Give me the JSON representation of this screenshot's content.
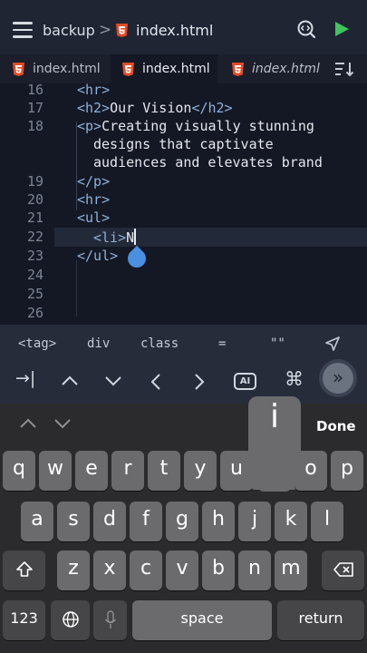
{
  "header": {
    "project": "backup",
    "separator": ">",
    "file": "index.html"
  },
  "tabs": [
    {
      "label": "index.html",
      "active": false
    },
    {
      "label": "index.html",
      "active": true
    },
    {
      "label": "index.html",
      "active": false
    }
  ],
  "editor": {
    "lines": [
      {
        "num": "16",
        "parts": [
          "<hr>"
        ]
      },
      {
        "num": "17",
        "parts": [
          "<h2>",
          "Our Vision",
          "</h2>"
        ]
      },
      {
        "num": "18",
        "parts": [
          "<p>",
          "Creating visually stunning"
        ]
      },
      {
        "num": "",
        "parts": [
          "designs that captivate"
        ]
      },
      {
        "num": "",
        "parts": [
          "audiences and elevates brand"
        ]
      },
      {
        "num": "19",
        "parts": [
          "</p>"
        ]
      },
      {
        "num": "20",
        "parts": [
          "<hr>"
        ]
      },
      {
        "num": "21",
        "parts": [
          "<ul>"
        ]
      },
      {
        "num": "22",
        "parts": [
          "<li>",
          "N"
        ]
      },
      {
        "num": "23",
        "parts": [
          "</ul>"
        ]
      },
      {
        "num": "24",
        "parts": []
      },
      {
        "num": "25",
        "parts": []
      },
      {
        "num": "26",
        "parts": []
      }
    ]
  },
  "snippets": [
    "<tag>",
    "div",
    "class",
    "=",
    "\"\""
  ],
  "toolbar": {
    "ai_label": "AI",
    "tab_icon": "→|",
    "up": "^",
    "cmd": "⌘"
  },
  "keyboard": {
    "done": "Done",
    "popup_letter": "i",
    "row1": [
      "q",
      "w",
      "e",
      "r",
      "t",
      "y",
      "u",
      "i",
      "o",
      "p"
    ],
    "row2": [
      "a",
      "s",
      "d",
      "f",
      "g",
      "h",
      "j",
      "k",
      "l"
    ],
    "row3": [
      "z",
      "x",
      "c",
      "v",
      "b",
      "n",
      "m"
    ],
    "numbers": "123",
    "space": "space",
    "return": "return"
  },
  "colors": {
    "accent_green": "#3fc55a",
    "tag_blue": "#8fb0d8",
    "drop_blue": "#4a8fe0",
    "html5_orange": "#e34c26"
  }
}
